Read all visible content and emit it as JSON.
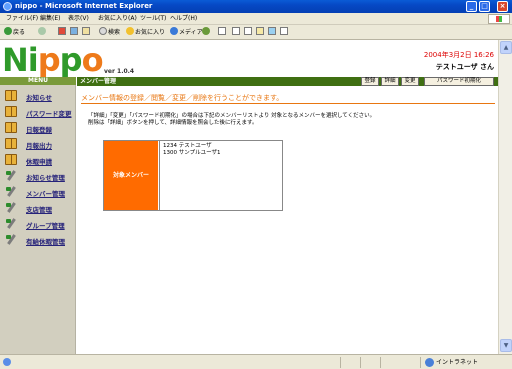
{
  "window": {
    "title": "nippo - Microsoft Internet Explorer",
    "minimize": "_",
    "maximize": "□",
    "close": "×"
  },
  "menubar": {
    "items": [
      "ファイル(F)",
      "編集(E)",
      "表示(V)",
      "お気に入り(A)",
      "ツール(T)",
      "ヘルプ(H)"
    ]
  },
  "toolbar": {
    "back": "戻る",
    "search": "検索",
    "favorites": "お気に入り",
    "media": "メディア"
  },
  "app": {
    "logo_letters": [
      "N",
      "i",
      "p",
      "p",
      "o"
    ],
    "version": "ver 1.0.4",
    "datetime": "2004年3月2日  16:26",
    "user": "テストユーザ  さん"
  },
  "sidebar": {
    "header": "MENU",
    "items": [
      {
        "label": "お知らせ",
        "icon": "book-icon"
      },
      {
        "label": "パスワード変更",
        "icon": "book-icon"
      },
      {
        "label": "日報登録",
        "icon": "book-icon"
      },
      {
        "label": "月報出力",
        "icon": "book-icon"
      },
      {
        "label": "休暇申請",
        "icon": "book-icon"
      },
      {
        "label": "お知らせ管理",
        "icon": "tool-icon"
      },
      {
        "label": "メンバー管理",
        "icon": "tool-icon"
      },
      {
        "label": "支店管理",
        "icon": "tool-icon"
      },
      {
        "label": "グループ管理",
        "icon": "tool-icon"
      },
      {
        "label": "有給休暇管理",
        "icon": "tool-icon"
      }
    ]
  },
  "main": {
    "section_title": "メンバー管理",
    "buttons": {
      "register": "登録",
      "detail": "詳細",
      "change": "変更",
      "reset_password": "パスワード初期化"
    },
    "heading": "メンバー情報の登録／閲覧／変更／削除を行うことができます。",
    "instruction_line1": "「詳細」「変更」「パスワード初期化」の場合は下記のメンバーリストより 対象となるメンバーを選択してください。",
    "instruction_line2": "削除は「詳細」ボタンを押して、詳細情報を照会した後に行えます。",
    "member_label": "対象メンバー",
    "members": [
      "1234 テストユーザ",
      "1300 サンプルユーザ1"
    ]
  },
  "statusbar": {
    "zone": "イントラネット"
  }
}
